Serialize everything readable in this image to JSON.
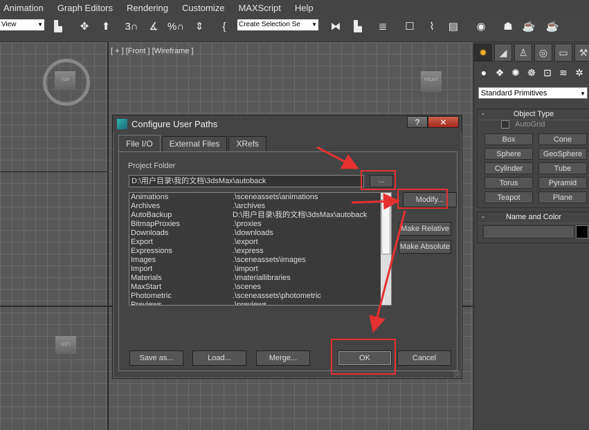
{
  "menu": [
    "Animation",
    "Graph Editors",
    "Rendering",
    "Customize",
    "MAXScript",
    "Help"
  ],
  "toolbar": {
    "view_dropdown": "View",
    "selection_set": "Create Selection Se",
    "snap_3": "3",
    "percent_snap": "%"
  },
  "viewport": {
    "label": "[ + ] [Front ] [Wireframe ]",
    "cube_top": "TOP",
    "cube_front": "FRONT",
    "cube_left": "LEFT"
  },
  "command_panel": {
    "category": "Standard Primitives",
    "object_type": "Object Type",
    "autogrid": "AutoGrid",
    "buttons": [
      "Box",
      "Cone",
      "Sphere",
      "GeoSphere",
      "Cylinder",
      "Tube",
      "Torus",
      "Pyramid",
      "Teapot",
      "Plane"
    ],
    "name_color": "Name and Color",
    "name_value": "",
    "swatch_color": "#000000"
  },
  "dialog": {
    "title": "Configure User Paths",
    "help": "?",
    "close": "✕",
    "tabs": [
      "File I/O",
      "External Files",
      "XRefs"
    ],
    "active_tab": "File I/O",
    "project_folder_label": "Project Folder",
    "project_folder_value": "D:\\用户目录\\我的文档\\3dsMax\\autoback",
    "browse": "...",
    "modify": "Modify...",
    "make_relative": "Make Relative",
    "make_absolute": "Make Absolute",
    "paths": [
      {
        "name": "Animations",
        "path": ".\\sceneassets\\animations"
      },
      {
        "name": "Archives",
        "path": ".\\archives"
      },
      {
        "name": "AutoBackup",
        "path": "D:\\用户目录\\我的文档\\3dsMax\\autoback"
      },
      {
        "name": "BitmapProxies",
        "path": ".\\proxies"
      },
      {
        "name": "Downloads",
        "path": ".\\downloads"
      },
      {
        "name": "Export",
        "path": ".\\export"
      },
      {
        "name": "Expressions",
        "path": ".\\express"
      },
      {
        "name": "Images",
        "path": ".\\sceneassets\\images"
      },
      {
        "name": "Import",
        "path": ".\\import"
      },
      {
        "name": "Materials",
        "path": ".\\materiallibraries"
      },
      {
        "name": "MaxStart",
        "path": ".\\scenes"
      },
      {
        "name": "Photometric",
        "path": ".\\sceneassets\\photometric"
      },
      {
        "name": "Previews",
        "path": ".\\previews"
      }
    ],
    "save_as": "Save as...",
    "load": "Load...",
    "merge": "Merge...",
    "ok": "OK",
    "cancel": "Cancel"
  },
  "colors": {
    "highlight": "#e63030",
    "accent": "#ffb020"
  }
}
